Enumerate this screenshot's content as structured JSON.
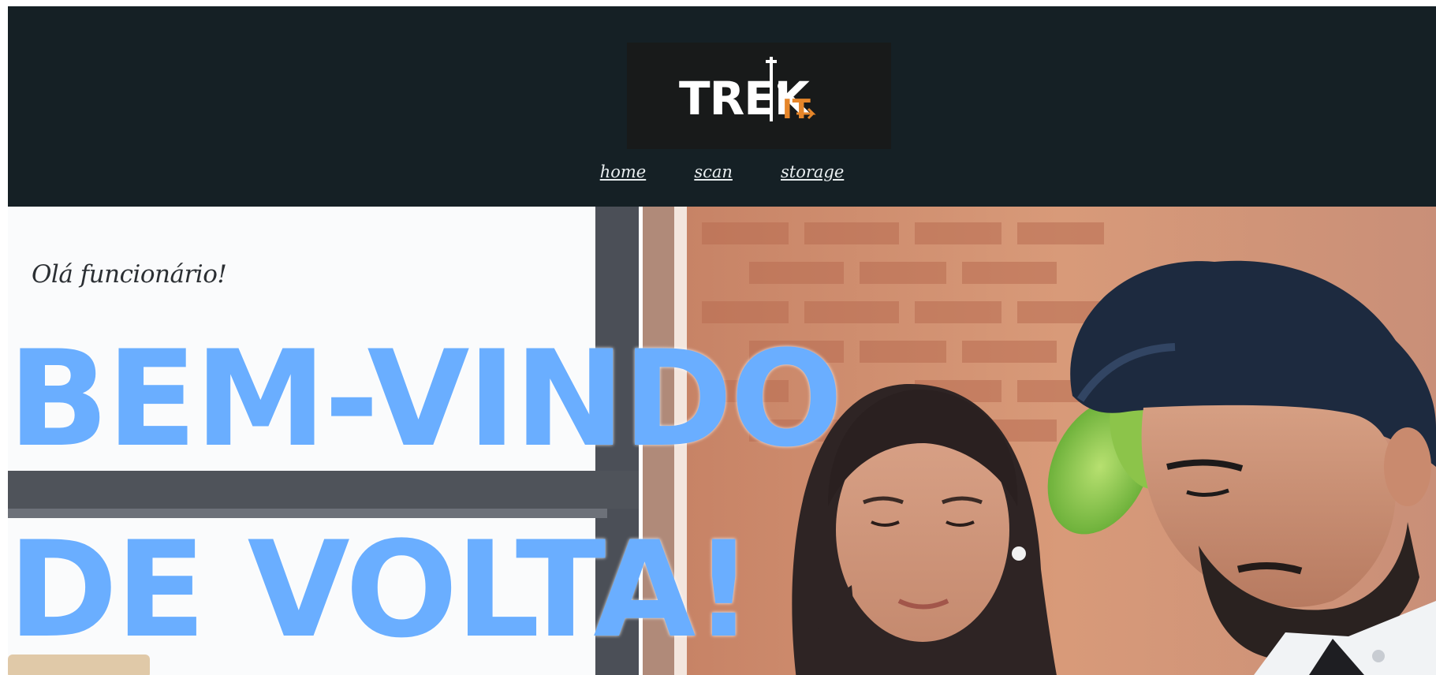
{
  "brand": {
    "logo_text": "TREK",
    "logo_suffix": "IT"
  },
  "nav": {
    "items": [
      {
        "label": "home"
      },
      {
        "label": "scan"
      },
      {
        "label": "storage"
      }
    ]
  },
  "hero": {
    "greeting": "Olá funcionário!",
    "headline_line1": "BEM-VINDO",
    "headline_line2": "DE VOLTA!"
  },
  "colors": {
    "header_bg": "#152025",
    "logo_bg": "#181a1a",
    "accent_orange": "#e6862a",
    "headline_blue": "#6aaeff"
  }
}
